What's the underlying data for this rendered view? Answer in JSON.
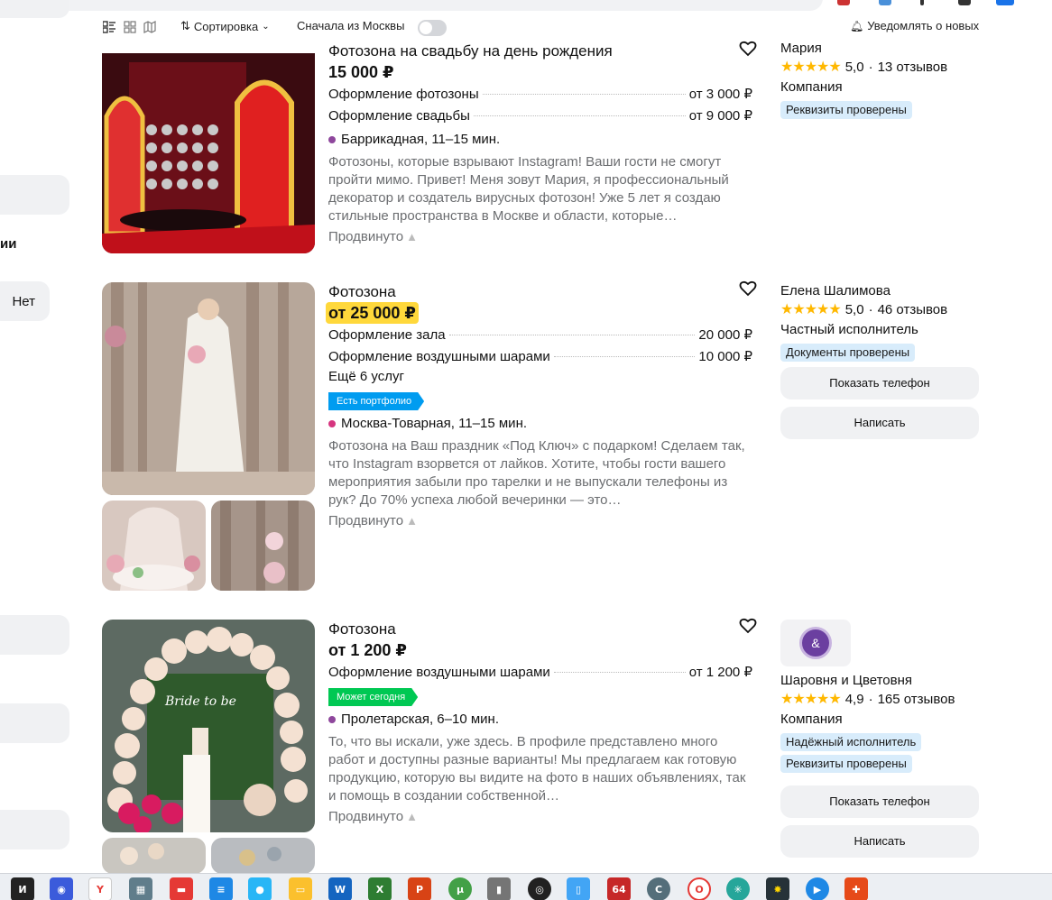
{
  "toolbar": {
    "sort_label": "Сортировка",
    "moscow_first_label": "Сначала из Москвы",
    "notify_label": "Уведомлять о новых"
  },
  "sidebar": {
    "fragment_text": "ии",
    "no_button": "Нет"
  },
  "listings": [
    {
      "title": "Фотозона на свадьбу на день рождения",
      "price": "15 000 ₽",
      "services": [
        {
          "name": "Оформление фотозоны",
          "price": "от 3 000 ₽"
        },
        {
          "name": "Оформление свадьбы",
          "price": "от 9 000 ₽"
        }
      ],
      "metro": "Баррикадная, 11–15 мин.",
      "metro_color": "#8e479c",
      "description": "Фотозоны, которые взрывают Instagram! Ваши гости не смогут пройти мимо. Привет! Меня зовут Мария, я профессиональный декоратор и создатель вирусных фотозон! Уже 5 лет я создаю стильные пространства в Москве и области, которые…",
      "promoted": "Продвинуто",
      "seller": {
        "name": "Мария",
        "rating": "5,0",
        "reviews": "13 отзывов",
        "type": "Компания",
        "badges": [
          "Реквизиты проверены"
        ]
      }
    },
    {
      "title": "Фотозона",
      "price": "от 25 000 ₽",
      "services": [
        {
          "name": "Оформление зала",
          "price": "20 000 ₽"
        },
        {
          "name": "Оформление воздушными шарами",
          "price": "10 000 ₽"
        }
      ],
      "more_services": "Ещё 6 услуг",
      "tag": "Есть портфолио",
      "tag_color": "#009cf0",
      "metro": "Москва-Товарная, 11–15 мин.",
      "metro_color": "#d6357f",
      "description": "Фотозона на Ваш праздник «Под Ключ» с подарком! Сделаем так, что Instagram взорвется от лайков. Хотите, чтобы гости вашего мероприятия забыли про тарелки и не выпускали телефоны из рук? До 70% успеха любой вечеринки — это…",
      "promoted": "Продвинуто",
      "seller": {
        "name": "Елена Шалимова",
        "rating": "5,0",
        "reviews": "46 отзывов",
        "type": "Частный исполнитель",
        "badges": [
          "Документы проверены"
        ],
        "phone_button": "Показать телефон",
        "message_button": "Написать"
      }
    },
    {
      "title": "Фотозона",
      "price": "от 1 200 ₽",
      "services": [
        {
          "name": "Оформление воздушными шарами",
          "price": "от 1 200 ₽"
        }
      ],
      "tag": "Может сегодня",
      "tag_color": "#00c853",
      "metro": "Пролетарская, 6–10 мин.",
      "metro_color": "#8e479c",
      "description": "То, что вы искали, уже здесь. В профиле представлено много работ и доступны разные варианты! Мы предлагаем как готовую продукцию, которую вы видите на фото в наших объявлениях, так и помощь в создании собственной…",
      "promoted": "Продвинуто",
      "seller": {
        "logo_text": "&",
        "name": "Шаровня и Цветовня",
        "rating": "4,9",
        "reviews": "165 отзывов",
        "type": "Компания",
        "badges": [
          "Надёжный исполнитель",
          "Реквизиты проверены"
        ],
        "phone_button": "Показать телефон",
        "message_button": "Написать"
      }
    }
  ],
  "taskbar": {
    "apps": [
      "obsidian-icon",
      "chromium-icon",
      "yandex-browser-icon",
      "calculator-icon",
      "presentation-icon",
      "notepad-icon",
      "maps-icon",
      "folder-icon",
      "word-icon",
      "excel-icon",
      "powerpoint-icon",
      "utorrent-icon",
      "usb-icon",
      "obs-icon",
      "phone-link-icon",
      "aida64-icon",
      "ccleaner-icon",
      "opera-icon",
      "network-icon",
      "star-icon",
      "media-player-icon",
      "puzzle-icon"
    ],
    "labels": {
      "aida": "64"
    }
  }
}
